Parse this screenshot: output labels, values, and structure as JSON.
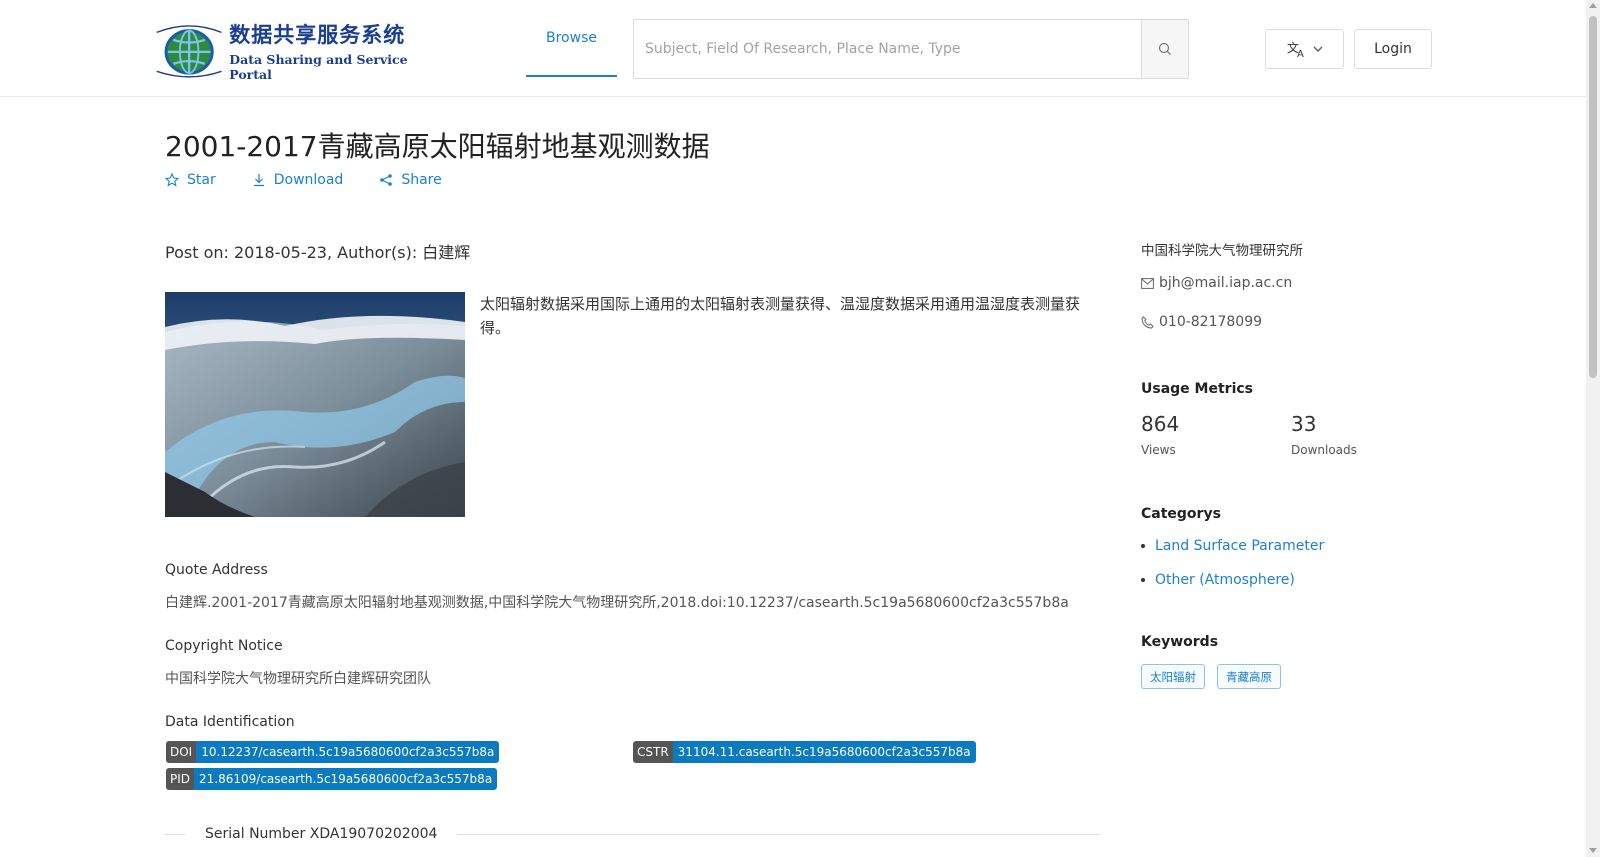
{
  "header": {
    "logo": {
      "cn": "数据共享服务系统",
      "en": "Data Sharing and Service Portal"
    },
    "nav_browse": "Browse",
    "search_placeholder": "Subject, Field Of Research, Place Name, Type",
    "login_label": "Login"
  },
  "page": {
    "title": "2001-2017青藏高原太阳辐射地基观测数据",
    "actions": {
      "star": "Star",
      "download": "Download",
      "share": "Share"
    },
    "meta": "Post on: 2018-05-23, Author(s): 白建辉",
    "description": "太阳辐射数据采用国际上通用的太阳辐射表测量获得、温湿度数据采用通用温湿度表测量获得。",
    "quote": {
      "label": "Quote Address",
      "text": "白建辉.2001-2017青藏高原太阳辐射地基观测数据,中国科学院大气物理研究所,2018.doi:10.12237/casearth.5c19a5680600cf2a3c557b8a"
    },
    "copyright": {
      "label": "Copyright Notice",
      "text": "中国科学院大气物理研究所白建辉研究团队"
    },
    "identification": {
      "label": "Data Identification",
      "doi": {
        "key": "DOI",
        "value": "10.12237/casearth.5c19a5680600cf2a3c557b8a"
      },
      "cstr": {
        "key": "CSTR",
        "value": "31104.11.casearth.5c19a5680600cf2a3c557b8a"
      },
      "pid": {
        "key": "PID",
        "value": "21.86109/casearth.5c19a5680600cf2a3c557b8a"
      }
    },
    "serial": "Serial Number XDA19070202004"
  },
  "sidebar": {
    "org": "中国科学院大气物理研究所",
    "email": "bjh@mail.iap.ac.cn",
    "phone": "010-82178099",
    "usage_heading": "Usage Metrics",
    "views": {
      "value": "864",
      "label": "Views"
    },
    "downloads": {
      "value": "33",
      "label": "Downloads"
    },
    "categories_heading": "Categorys",
    "categories": [
      "Land Surface Parameter",
      "Other (Atmosphere)"
    ],
    "keywords_heading": "Keywords",
    "keywords": [
      "太阳辐射",
      "青藏高原"
    ]
  },
  "colors": {
    "accent": "#1d7fd1",
    "badge_key": "#555555",
    "badge_value": "#0a7bc1"
  }
}
